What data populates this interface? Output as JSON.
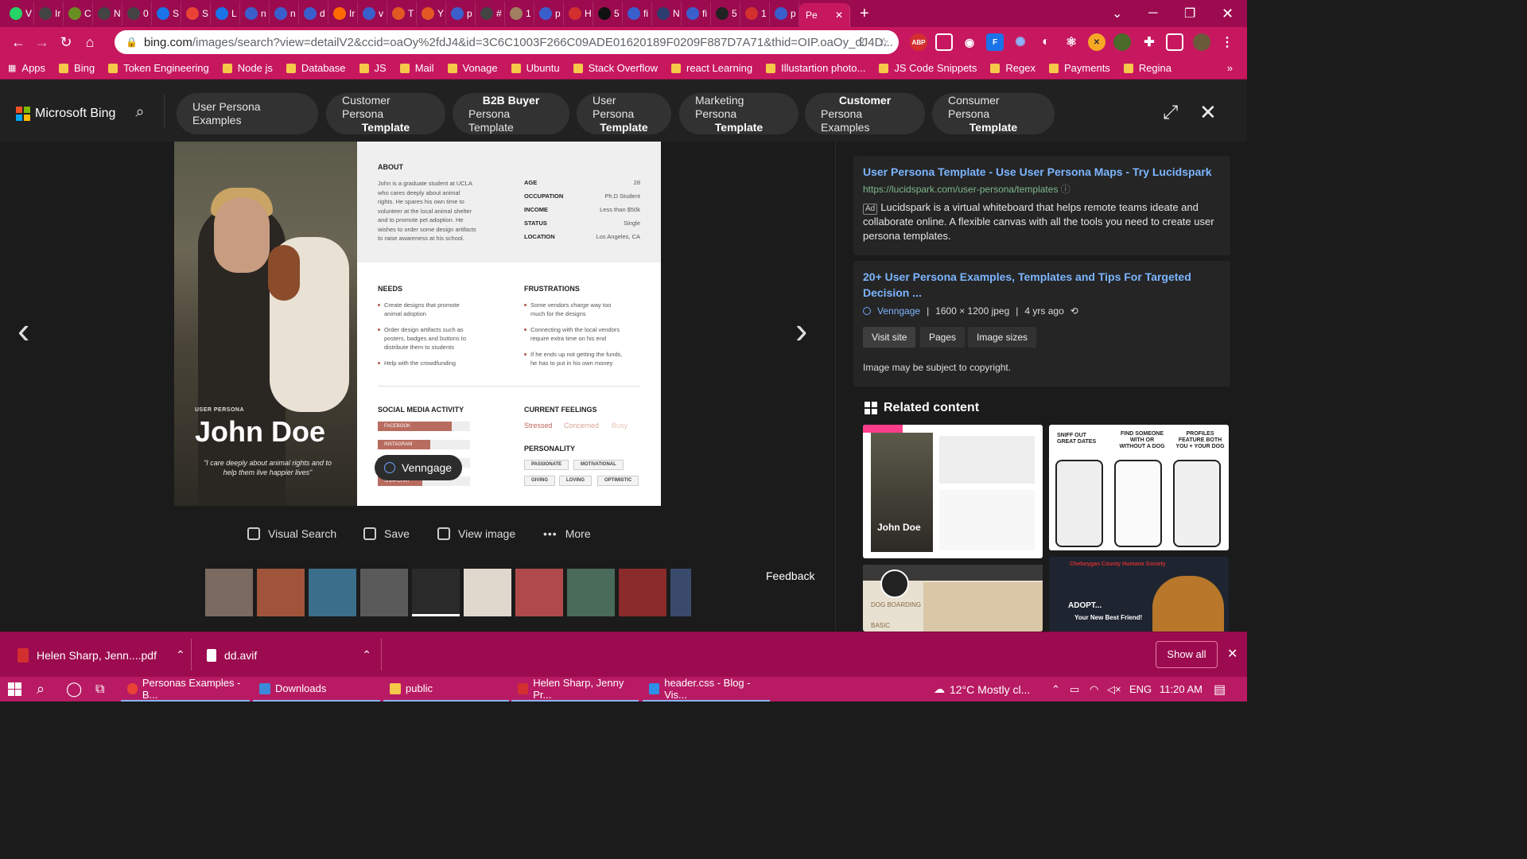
{
  "browser": {
    "tabs": [
      {
        "icon": "whatsapp-icon",
        "label": "V",
        "color": "#25d366"
      },
      {
        "icon": "globe-icon",
        "label": "Ir",
        "color": "#444"
      },
      {
        "icon": "token-icon",
        "label": "C",
        "color": "#6b8e23"
      },
      {
        "icon": "globe-icon",
        "label": "N",
        "color": "#444"
      },
      {
        "icon": "globe-icon",
        "label": "0",
        "color": "#444"
      },
      {
        "icon": "s-icon",
        "label": "S",
        "color": "#1a73e8"
      },
      {
        "icon": "gmail-icon",
        "label": "S",
        "color": "#ea4335"
      },
      {
        "icon": "u-icon",
        "label": "L",
        "color": "#1a73e8"
      },
      {
        "icon": "search-icon",
        "label": "n",
        "color": "#3a5fcd"
      },
      {
        "icon": "search-icon",
        "label": "n",
        "color": "#3a5fcd"
      },
      {
        "icon": "search-icon",
        "label": "d",
        "color": "#3a5fcd"
      },
      {
        "icon": "c-icon",
        "label": "Ir",
        "color": "#ff6a00"
      },
      {
        "icon": "search-icon",
        "label": "v",
        "color": "#3a5fcd"
      },
      {
        "icon": "t-icon",
        "label": "T",
        "color": "#e25822"
      },
      {
        "icon": "y-icon",
        "label": "Y",
        "color": "#e25822"
      },
      {
        "icon": "search-icon",
        "label": "p",
        "color": "#3a5fcd"
      },
      {
        "icon": "globe-icon",
        "label": "#",
        "color": "#444"
      },
      {
        "icon": "avatar-icon",
        "label": "1",
        "color": "#a08060"
      },
      {
        "icon": "search-icon",
        "label": "p",
        "color": "#3a5fcd"
      },
      {
        "icon": "info-icon",
        "label": "H",
        "color": "#d32f2f"
      },
      {
        "icon": "b-icon",
        "label": "5",
        "color": "#111"
      },
      {
        "icon": "search-icon",
        "label": "fi",
        "color": "#3a5fcd"
      },
      {
        "icon": "media-icon",
        "label": "N",
        "color": "#2c3e70"
      },
      {
        "icon": "search-icon",
        "label": "fi",
        "color": "#3a5fcd"
      },
      {
        "icon": "aoc-icon",
        "label": "5",
        "color": "#222"
      },
      {
        "icon": "ms-icon",
        "label": "1",
        "color": "#d32f2f"
      },
      {
        "icon": "search-icon",
        "label": "p",
        "color": "#3a5fcd"
      }
    ],
    "active_tab": {
      "label": "Pe"
    },
    "address": {
      "host": "bing.com",
      "path": "/images/search?view=detailV2&ccid=oaOy%2fdJ4&id=3C6C1003F266C09ADE01620189F0209F887D7A71&thid=OIP.oaOy_dJ4D..."
    },
    "bookmarks": [
      "Apps",
      "Bing",
      "Token Engineering",
      "Node js",
      "Database",
      "JS",
      "Mail",
      "Vonage",
      "Ubuntu",
      "Stack Overflow",
      "react Learning",
      "Illustartion photo...",
      "JS Code Snippets",
      "Regex",
      "Payments",
      "Regina"
    ],
    "bookmarks_more": "»"
  },
  "bing": {
    "logo_text": "Microsoft Bing",
    "related_searches": [
      {
        "line1": "User Persona Examples",
        "line2": ""
      },
      {
        "line1": "Customer Persona",
        "line2": "Template"
      },
      {
        "line1": "B2B Buyer",
        "line2": "Persona Template"
      },
      {
        "line1": "User Persona",
        "line2": "Template"
      },
      {
        "line1": "Marketing Persona",
        "line2": "Template"
      },
      {
        "line1": "Customer",
        "line2": "Persona Examples"
      },
      {
        "line1": "Consumer Persona",
        "line2": "Template"
      }
    ]
  },
  "persona": {
    "label": "USER PERSONA",
    "name": "John Doe",
    "quote": "\"I care deeply about animal rights and to help them live happier lives\"",
    "about_title": "ABOUT",
    "about_lines": [
      "John is a graduate student at UCLA",
      "who cares deeply about animal",
      "rights. He spares his own time to",
      "volunteer at the local animal shelter",
      "and to promote pet adoption. He",
      "wishes to order some design artifacts",
      "to raise awareness at his school."
    ],
    "facts": [
      {
        "k": "AGE",
        "v": "28"
      },
      {
        "k": "OCCUPATION",
        "v": "Ph.D Student"
      },
      {
        "k": "INCOME",
        "v": "Less than $50k"
      },
      {
        "k": "STATUS",
        "v": "Single"
      },
      {
        "k": "LOCATION",
        "v": "Los Angeles, CA"
      }
    ],
    "needs_title": "NEEDS",
    "needs": [
      [
        "Create designs that promote",
        "animal adoption"
      ],
      [
        "Order design artifacts such as",
        "posters, badges and buttons to",
        "distribute them to students"
      ],
      [
        "Help with the crowdfunding"
      ]
    ],
    "frustrations_title": "FRUSTRATIONS",
    "frustrations": [
      [
        "Some vendors charge way too",
        "much for the designs"
      ],
      [
        "Connecting with the local vendors",
        "require extra time on his end"
      ],
      [
        "If he ends up not getting the funds,",
        "he has to put in his own money"
      ]
    ],
    "social_title": "SOCIAL MEDIA ACTIVITY",
    "social": [
      {
        "name": "FACEBOOK",
        "level": 0.8
      },
      {
        "name": "INSTAGRAM",
        "level": 0.57
      },
      {
        "name": "",
        "level": 0.5
      },
      {
        "name": "SNAPCHAT",
        "level": 0.48
      }
    ],
    "feelings_title": "CURRENT FEELINGS",
    "feelings": [
      {
        "t": "Stressed",
        "c": "#c0675a"
      },
      {
        "t": "Concerned",
        "c": "#d9a496"
      },
      {
        "t": "Busy",
        "c": "#e8c4b8"
      }
    ],
    "personality_title": "PERSONALITY",
    "personality": [
      "PASSIONATE",
      "MOTIVATIONAL",
      "GIVING",
      "LOVING",
      "OPTIMISTIC"
    ],
    "watermark": "Venngage"
  },
  "actions": {
    "visual_search": "Visual Search",
    "save": "Save",
    "view_image": "View image",
    "more": "More"
  },
  "feedback": "Feedback",
  "panel": {
    "ad": {
      "title": "User Persona Template - Use User Persona Maps - Try Lucidspark",
      "url": "https://lucidspark.com/user-persona/templates",
      "ad_label": "Ad",
      "desc": "Lucidspark is a virtual whiteboard that helps remote teams ideate and collaborate online. A flexible canvas with all the tools you need to create user persona templates."
    },
    "result": {
      "title": "20+ User Persona Examples, Templates and Tips For Targeted Decision ...",
      "source": "Venngage",
      "dims": "1600 × 1200 jpeg",
      "age": "4 yrs ago",
      "buttons": [
        "Visit site",
        "Pages",
        "Image sizes"
      ],
      "copyright": "Image may be subject to copyright."
    },
    "related_title": "Related content",
    "related": [
      {
        "caption": "John Doe"
      },
      {
        "caption1": "SNIFF OUT GREAT DATES",
        "caption2": "FIND SOMEONE WITH OR WITHOUT A DOG",
        "caption3": "PROFILES FEATURE BOTH YOU + YOUR DOG"
      },
      {
        "caption": "DOG BOARDING",
        "caption2": "BASIC"
      },
      {
        "caption": "Cheboygan County Humane Society",
        "caption2": "ADOPT...",
        "caption3": "Your New Best Friend!"
      }
    ]
  },
  "downloads": {
    "items": [
      {
        "name": "Helen Sharp, Jenn....pdf",
        "icon": "pdf-icon"
      },
      {
        "name": "dd.avif",
        "icon": "file-icon"
      }
    ],
    "show_all": "Show all"
  },
  "taskbar": {
    "apps": [
      {
        "label": "Personas Examples - B...",
        "icon": "chrome-icon"
      },
      {
        "label": "Downloads",
        "icon": "download-icon"
      },
      {
        "label": "public",
        "icon": "folder-icon"
      },
      {
        "label": "Helen Sharp, Jenny Pr...",
        "icon": "pdf-icon"
      },
      {
        "label": "header.css - Blog - Vis...",
        "icon": "vscode-icon"
      }
    ],
    "weather": "12°C  Mostly cl...",
    "lang": "ENG",
    "time": "11:20 AM"
  }
}
